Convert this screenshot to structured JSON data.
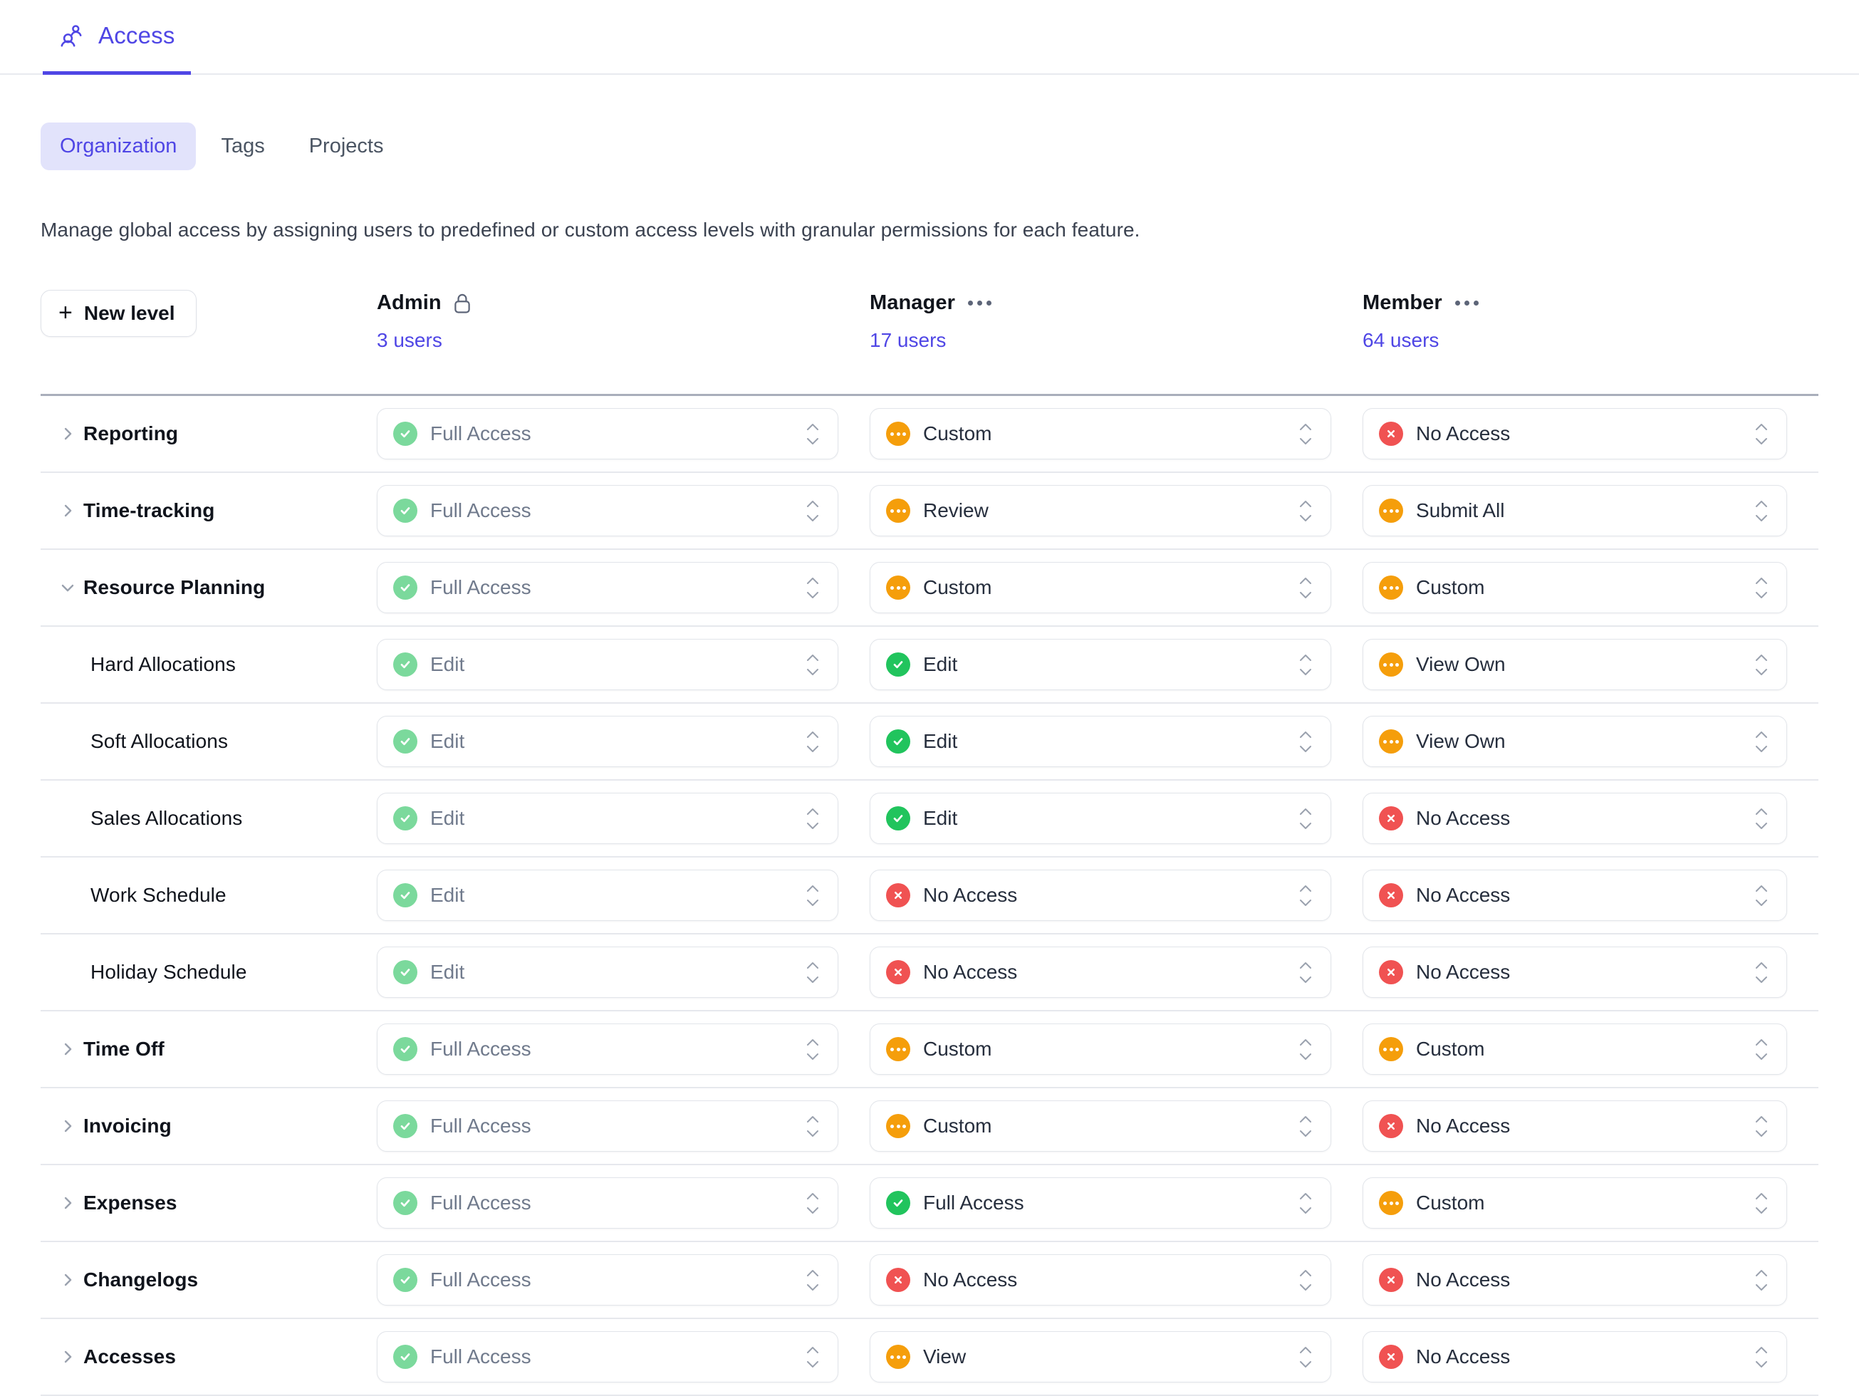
{
  "topbar": {
    "title": "Access",
    "icon": "people-icon"
  },
  "tabs": [
    {
      "label": "Organization",
      "active": true
    },
    {
      "label": "Tags",
      "active": false
    },
    {
      "label": "Projects",
      "active": false
    }
  ],
  "description": "Manage global access by assigning users to predefined or custom access levels with granular permissions for each feature.",
  "toolbar": {
    "new_level_label": "New level",
    "plus": "+"
  },
  "columns": [
    {
      "name": "Admin",
      "users": "3 users",
      "locked": true,
      "menu": false
    },
    {
      "name": "Manager",
      "users": "17 users",
      "locked": false,
      "menu": true
    },
    {
      "name": "Member",
      "users": "64 users",
      "locked": false,
      "menu": true
    }
  ],
  "rows": [
    {
      "name": "Reporting",
      "level": "parent",
      "expanded": false,
      "values": [
        {
          "label": "Full Access",
          "state": "green-mute",
          "muted": true
        },
        {
          "label": "Custom",
          "state": "orange",
          "muted": false
        },
        {
          "label": "No Access",
          "state": "red",
          "muted": false
        }
      ]
    },
    {
      "name": "Time-tracking",
      "level": "parent",
      "expanded": false,
      "values": [
        {
          "label": "Full Access",
          "state": "green-mute",
          "muted": true
        },
        {
          "label": "Review",
          "state": "orange",
          "muted": false
        },
        {
          "label": "Submit All",
          "state": "orange",
          "muted": false
        }
      ]
    },
    {
      "name": "Resource Planning",
      "level": "parent",
      "expanded": true,
      "values": [
        {
          "label": "Full Access",
          "state": "green-mute",
          "muted": true
        },
        {
          "label": "Custom",
          "state": "orange",
          "muted": false
        },
        {
          "label": "Custom",
          "state": "orange",
          "muted": false
        }
      ]
    },
    {
      "name": "Hard Allocations",
      "level": "child",
      "expanded": null,
      "values": [
        {
          "label": "Edit",
          "state": "green-mute",
          "muted": true
        },
        {
          "label": "Edit",
          "state": "green",
          "muted": false
        },
        {
          "label": "View Own",
          "state": "orange",
          "muted": false
        }
      ]
    },
    {
      "name": "Soft Allocations",
      "level": "child",
      "expanded": null,
      "values": [
        {
          "label": "Edit",
          "state": "green-mute",
          "muted": true
        },
        {
          "label": "Edit",
          "state": "green",
          "muted": false
        },
        {
          "label": "View Own",
          "state": "orange",
          "muted": false
        }
      ]
    },
    {
      "name": "Sales Allocations",
      "level": "child",
      "expanded": null,
      "values": [
        {
          "label": "Edit",
          "state": "green-mute",
          "muted": true
        },
        {
          "label": "Edit",
          "state": "green",
          "muted": false
        },
        {
          "label": "No Access",
          "state": "red",
          "muted": false
        }
      ]
    },
    {
      "name": "Work Schedule",
      "level": "child",
      "expanded": null,
      "values": [
        {
          "label": "Edit",
          "state": "green-mute",
          "muted": true
        },
        {
          "label": "No Access",
          "state": "red",
          "muted": false
        },
        {
          "label": "No Access",
          "state": "red",
          "muted": false
        }
      ]
    },
    {
      "name": "Holiday Schedule",
      "level": "child",
      "expanded": null,
      "values": [
        {
          "label": "Edit",
          "state": "green-mute",
          "muted": true
        },
        {
          "label": "No Access",
          "state": "red",
          "muted": false
        },
        {
          "label": "No Access",
          "state": "red",
          "muted": false
        }
      ]
    },
    {
      "name": "Time Off",
      "level": "parent",
      "expanded": false,
      "values": [
        {
          "label": "Full Access",
          "state": "green-mute",
          "muted": true
        },
        {
          "label": "Custom",
          "state": "orange",
          "muted": false
        },
        {
          "label": "Custom",
          "state": "orange",
          "muted": false
        }
      ]
    },
    {
      "name": "Invoicing",
      "level": "parent",
      "expanded": false,
      "values": [
        {
          "label": "Full Access",
          "state": "green-mute",
          "muted": true
        },
        {
          "label": "Custom",
          "state": "orange",
          "muted": false
        },
        {
          "label": "No Access",
          "state": "red",
          "muted": false
        }
      ]
    },
    {
      "name": "Expenses",
      "level": "parent",
      "expanded": false,
      "values": [
        {
          "label": "Full Access",
          "state": "green-mute",
          "muted": true
        },
        {
          "label": "Full Access",
          "state": "green",
          "muted": false
        },
        {
          "label": "Custom",
          "state": "orange",
          "muted": false
        }
      ]
    },
    {
      "name": "Changelogs",
      "level": "parent",
      "expanded": false,
      "values": [
        {
          "label": "Full Access",
          "state": "green-mute",
          "muted": true
        },
        {
          "label": "No Access",
          "state": "red",
          "muted": false
        },
        {
          "label": "No Access",
          "state": "red",
          "muted": false
        }
      ]
    },
    {
      "name": "Accesses",
      "level": "parent",
      "expanded": false,
      "values": [
        {
          "label": "Full Access",
          "state": "green-mute",
          "muted": true
        },
        {
          "label": "View",
          "state": "orange",
          "muted": false
        },
        {
          "label": "No Access",
          "state": "red",
          "muted": false
        }
      ]
    }
  ],
  "colors": {
    "accent": "#4f46e5",
    "tab_active_bg": "#e2e3fb",
    "green": "#21c45d",
    "green_muted": "#7bd99c",
    "red": "#f05252",
    "orange": "#f59e0b",
    "text": "#10141c",
    "text_muted": "#707a8c"
  }
}
